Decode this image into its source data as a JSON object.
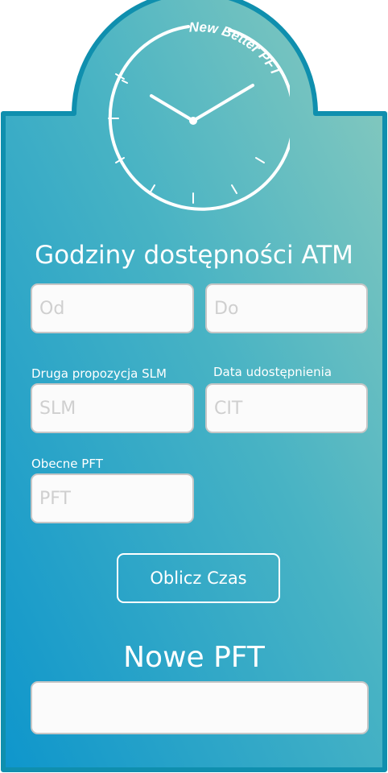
{
  "brand_text": "New Better PFT",
  "colors": {
    "gradient_light": "#80c6be",
    "gradient_dark": "#1598c6",
    "border": "#0f8fae",
    "field_bg": "#fbfbfb",
    "text": "#ffffff"
  },
  "atm_section": {
    "heading": "Godziny dostępności ATM",
    "from_placeholder": "Od",
    "to_placeholder": "Do"
  },
  "slm_field": {
    "label": "Druga propozycja SLM",
    "placeholder": "SLM"
  },
  "cit_field": {
    "label": "Data udostępnienia",
    "placeholder": "CIT"
  },
  "pft_field": {
    "label": "Obecne PFT",
    "placeholder": "PFT"
  },
  "calculate_button": {
    "label": "Oblicz Czas"
  },
  "result": {
    "title": "Nowe PFT",
    "value": ""
  }
}
